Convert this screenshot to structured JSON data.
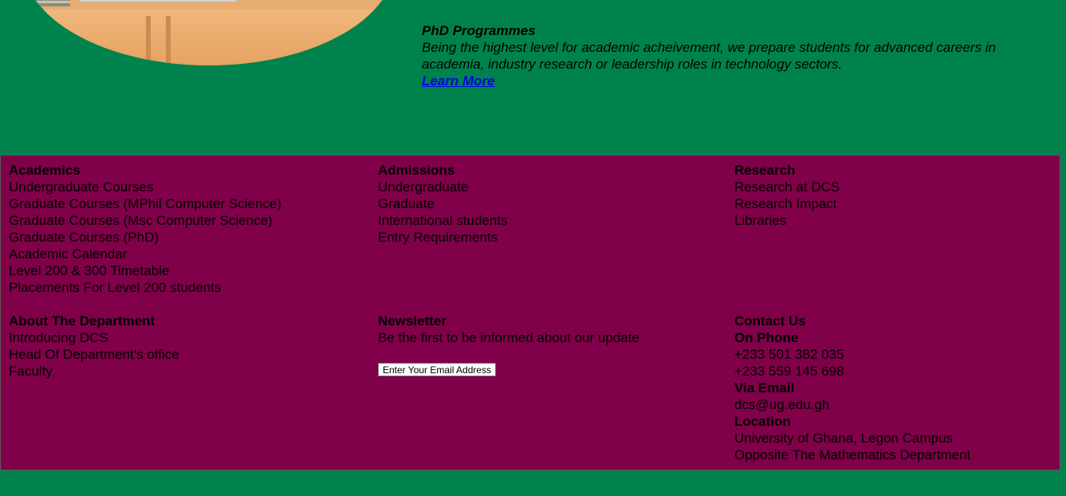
{
  "hero": {
    "title": "PhD Programmes",
    "description": "Being the highest level for academic acheivement, we prepare students for advanced careers in academia, industry research or leadership roles in technology sectors.",
    "link": "Learn More"
  },
  "footer": {
    "academics": {
      "heading": "Academics",
      "items": [
        "Undergraduate Courses",
        "Graduate Courses (MPhil Computer Science)",
        "Graduate Courses (Msc Computer Science)",
        "Graduate Courses (PhD)",
        "Academic Calendar",
        "Level 200 & 300 Timetable",
        "Placements For Level 200 students"
      ]
    },
    "admissions": {
      "heading": "Admissions",
      "items": [
        "Undergraduate",
        "Graduate",
        "International students",
        "Entry Requirements"
      ]
    },
    "research": {
      "heading": "Research",
      "items": [
        "Research at DCS",
        "Research Impact",
        "Libraries"
      ]
    },
    "about": {
      "heading": "About The Department",
      "items": [
        "Introducing DCS",
        "Head Of Department's office",
        "Faculty"
      ]
    },
    "newsletter": {
      "heading": "Newsletter",
      "text": "Be the first to be informed about our update",
      "placeholder": "Enter Your Email Address"
    },
    "contact": {
      "heading": "Contact Us",
      "phone_heading": "On Phone",
      "phones": [
        "+233 501 382 035",
        "+233 559 145 698"
      ],
      "email_heading": "Via Email",
      "email": "dcs@ug.edu.gh",
      "location_heading": "Location",
      "location": [
        "University of Ghana, Legon Campus",
        "Opposite The Mathematics Department"
      ]
    }
  },
  "colors": {
    "page_background": "#00824c",
    "footer_background": "#80004a",
    "link": "#0000ee"
  }
}
